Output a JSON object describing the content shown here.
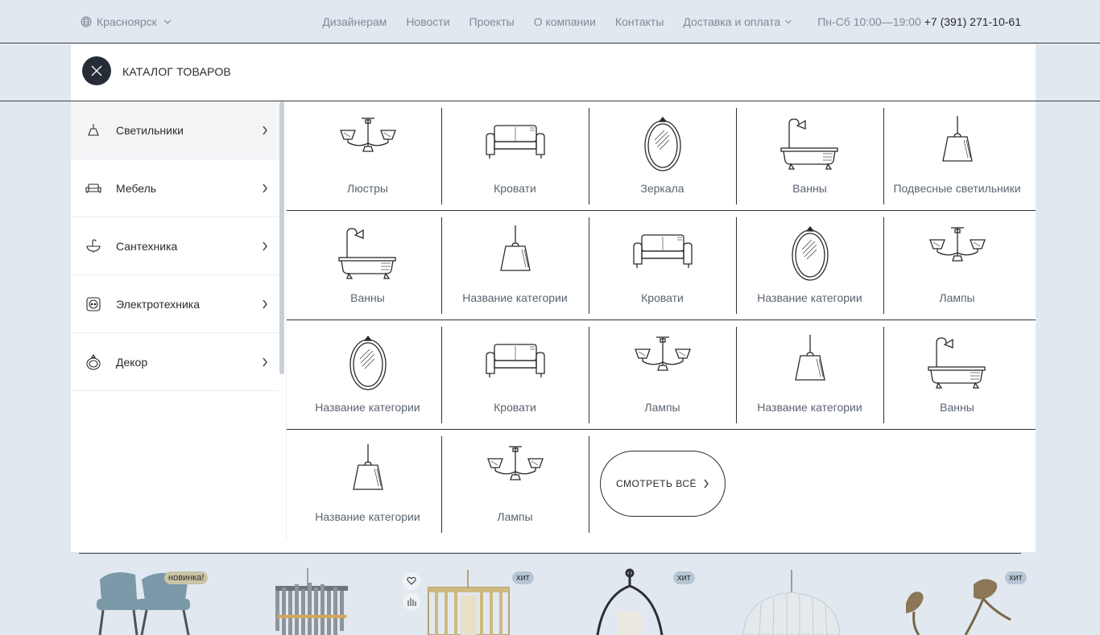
{
  "header": {
    "city": "Красноярск",
    "nav": [
      "Дизайнерам",
      "Новости",
      "Проекты",
      "О компании",
      "Контакты",
      "Доставка и оплата"
    ],
    "hours": "Пн-Сб 10:00—19:00",
    "phone": "+7 (391) 271-10-61"
  },
  "catalog": {
    "title": "КАТАЛОГ ТОВАРОВ",
    "sidebar": [
      {
        "label": "Светильники",
        "icon": "lamp-icon",
        "active": true
      },
      {
        "label": "Мебель",
        "icon": "sofa-icon",
        "active": false
      },
      {
        "label": "Сантехника",
        "icon": "sink-icon",
        "active": false
      },
      {
        "label": "Электротехника",
        "icon": "socket-icon",
        "active": false
      },
      {
        "label": "Декор",
        "icon": "decor-icon",
        "active": false
      }
    ],
    "categories": [
      {
        "label": "Люстры",
        "icon": "chandelier-icon"
      },
      {
        "label": "Кровати",
        "icon": "sofa-icon"
      },
      {
        "label": "Зеркала",
        "icon": "mirror-icon"
      },
      {
        "label": "Ванны",
        "icon": "bathtub-icon"
      },
      {
        "label": "Подвесные светильники",
        "icon": "pendant-lamp-icon"
      },
      {
        "label": "Ванны",
        "icon": "bathtub-icon"
      },
      {
        "label": "Название категории",
        "icon": "pendant-lamp-icon"
      },
      {
        "label": "Кровати",
        "icon": "sofa-icon"
      },
      {
        "label": "Название категории",
        "icon": "mirror-icon"
      },
      {
        "label": "Лампы",
        "icon": "chandelier-icon"
      },
      {
        "label": "Название категории",
        "icon": "mirror-icon"
      },
      {
        "label": "Кровати",
        "icon": "sofa-icon"
      },
      {
        "label": "Лампы",
        "icon": "chandelier-icon"
      },
      {
        "label": "Название категории",
        "icon": "pendant-lamp-icon"
      },
      {
        "label": "Ванны",
        "icon": "bathtub-icon"
      },
      {
        "label": "Название категории",
        "icon": "pendant-lamp-icon"
      },
      {
        "label": "Лампы",
        "icon": "chandelier-icon"
      }
    ],
    "see_all": "СМОТРЕТЬ ВСЁ"
  },
  "products": [
    {
      "image": "chairs-image",
      "badge": "новинка!",
      "badge_type": "new"
    },
    {
      "image": "crystal-chandelier-image",
      "badge": "",
      "badge_type": ""
    },
    {
      "image": "brass-lantern-image",
      "badge": "хит",
      "badge_type": "hit"
    },
    {
      "image": "black-pendant-image",
      "badge": "хит",
      "badge_type": "hit"
    },
    {
      "image": "glass-chandelier-image",
      "badge": "",
      "badge_type": ""
    },
    {
      "image": "birds-figurine-image",
      "badge": "хит",
      "badge_type": "hit"
    }
  ]
}
